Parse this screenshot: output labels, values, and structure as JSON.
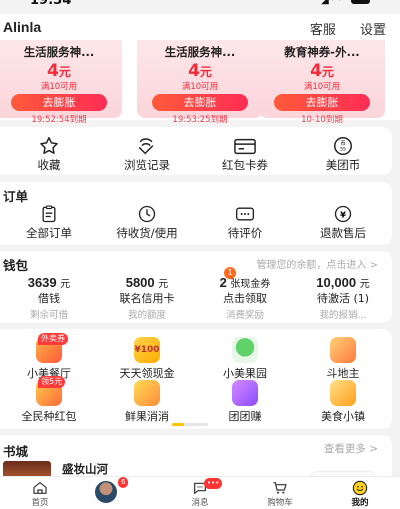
{
  "status": {
    "time": "19:34",
    "battery": "96"
  },
  "header": {
    "username": "Alinla",
    "customer_service": "客服",
    "settings": "设置"
  },
  "coupons": [
    {
      "title": "生活服务神...",
      "amount": "4",
      "unit": "元",
      "condition": "满10可用",
      "button": "去膨胀",
      "expire": "19:52:54到期"
    },
    {
      "title": "生活服务神...",
      "amount": "4",
      "unit": "元",
      "condition": "满10可用",
      "button": "去膨胀",
      "expire": "19:53:25到期"
    },
    {
      "title": "教育神券-外...",
      "amount": "4",
      "unit": "元",
      "condition": "满10可用",
      "button": "去膨胀",
      "expire": "10-10到期"
    }
  ],
  "quick": [
    {
      "label": "收藏",
      "icon": "star-icon"
    },
    {
      "label": "浏览记录",
      "icon": "history-icon"
    },
    {
      "label": "红包卡券",
      "icon": "coupon-card-icon"
    },
    {
      "label": "美团币",
      "icon": "meituan-coin-icon",
      "icon_text": "55"
    }
  ],
  "orders": {
    "title": "订单",
    "items": [
      {
        "label": "全部订单",
        "icon": "order-list-icon"
      },
      {
        "label": "待收货/使用",
        "icon": "clock-icon"
      },
      {
        "label": "待评价",
        "icon": "comment-icon"
      },
      {
        "label": "退款售后",
        "icon": "refund-icon"
      }
    ]
  },
  "wallet": {
    "title": "钱包",
    "more": "管理您的余额，点击进入 >",
    "badge": "1",
    "items": [
      {
        "value": "3639",
        "unit": "元",
        "name": "借钱",
        "sub": "剩余可借"
      },
      {
        "value": "5800",
        "unit": "元",
        "name": "联名信用卡",
        "sub": "我的额度"
      },
      {
        "value": "2",
        "unit": "张现金券",
        "name": "点击领取",
        "sub": "消费奖励"
      },
      {
        "value": "10,000",
        "unit": "元",
        "name": "待激活 (1)",
        "sub": "我的报销..."
      }
    ]
  },
  "apps": {
    "row1": [
      {
        "label": "小美餐厅",
        "tag": "外卖券",
        "color": "#ff6a3a"
      },
      {
        "label": "天天领现金",
        "tag": "",
        "color": "#ffb300"
      },
      {
        "label": "小美果园",
        "tag": "",
        "color": "#38c56b"
      },
      {
        "label": "斗地主",
        "tag": "",
        "color": "#3aa0ff"
      }
    ],
    "row2": [
      {
        "label": "全民种红包",
        "tag": "领5元",
        "color": "#ff4d4d"
      },
      {
        "label": "鲜果消消",
        "tag": "",
        "color": "#ff8a3a"
      },
      {
        "label": "团团赚",
        "tag": "",
        "color": "#b36bff"
      },
      {
        "label": "美食小镇",
        "tag": "",
        "color": "#ff9f1a"
      }
    ],
    "app_icon_text": "¥100"
  },
  "books": {
    "title": "书城",
    "more": "查看更多 >",
    "item_title": "盛妆山河"
  },
  "tabbar": [
    {
      "label": "首页",
      "icon": "home-icon"
    },
    {
      "label": "",
      "icon": "avatar",
      "badge": "6"
    },
    {
      "label": "消息",
      "icon": "message-icon",
      "badge": "•••"
    },
    {
      "label": "购物车",
      "icon": "cart-icon"
    },
    {
      "label": "我的",
      "icon": "me-smile-icon"
    }
  ],
  "colors": {
    "accent": "#ff2d55",
    "brand_yellow": "#ffc300"
  }
}
